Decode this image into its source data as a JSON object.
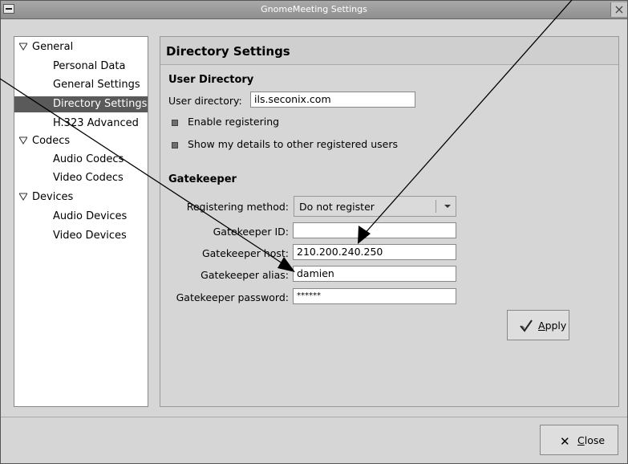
{
  "window": {
    "title": "GnomeMeeting Settings"
  },
  "tree": {
    "groups": [
      {
        "label": "General",
        "children": [
          "Personal Data",
          "General Settings",
          "Directory Settings",
          "H.323 Advanced"
        ]
      },
      {
        "label": "Codecs",
        "children": [
          "Audio Codecs",
          "Video Codecs"
        ]
      },
      {
        "label": "Devices",
        "children": [
          "Audio Devices",
          "Video Devices"
        ]
      }
    ],
    "selected": "Directory Settings"
  },
  "content": {
    "title": "Directory Settings",
    "user_directory": {
      "section_title": "User Directory",
      "directory_label": "User directory:",
      "directory_value": "ils.seconix.com",
      "enable_registering": "Enable registering",
      "show_details": "Show my details to other registered users"
    },
    "gatekeeper": {
      "section_title": "Gatekeeper",
      "method_label": "Registering method:",
      "method_value": "Do not register",
      "id_label": "Gatekeeper ID:",
      "id_value": "",
      "host_label": "Gatekeeper host:",
      "host_value": "210.200.240.250",
      "alias_label": "Gatekeeper alias:",
      "alias_value": "damien",
      "password_label": "Gatekeeper password:",
      "password_value": "******"
    },
    "apply_label": "Apply"
  },
  "footer": {
    "close_label": "Close"
  },
  "icons": {
    "apply": "checkmark-icon",
    "close": "x-icon"
  }
}
